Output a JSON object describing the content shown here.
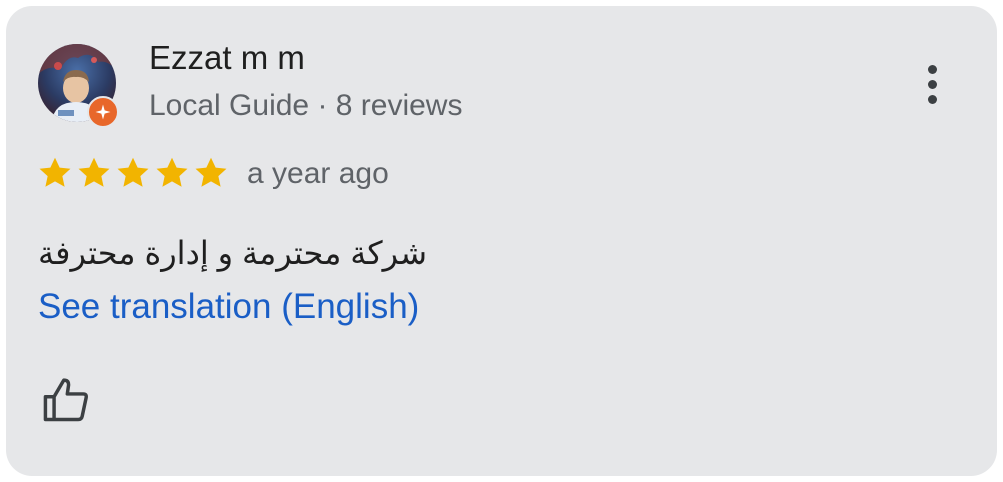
{
  "review": {
    "author": {
      "name": "Ezzat m m",
      "meta": "Local Guide · 8 reviews",
      "avatar_icon": "profile-photo",
      "badge_icon": "local-guide-star-badge"
    },
    "rating": {
      "stars": 5,
      "max": 5,
      "color": "#f2b400"
    },
    "time": "a year ago",
    "text": "شركة محترمة و إدارة محترفة",
    "translate_link": "See translation (English)",
    "actions": {
      "more_icon": "more-vert-icon",
      "like_icon": "thumb-up-outline-icon"
    }
  },
  "colors": {
    "card_bg": "#e6e7e9",
    "link": "#1a5ec6",
    "badge": "#e8672a"
  }
}
